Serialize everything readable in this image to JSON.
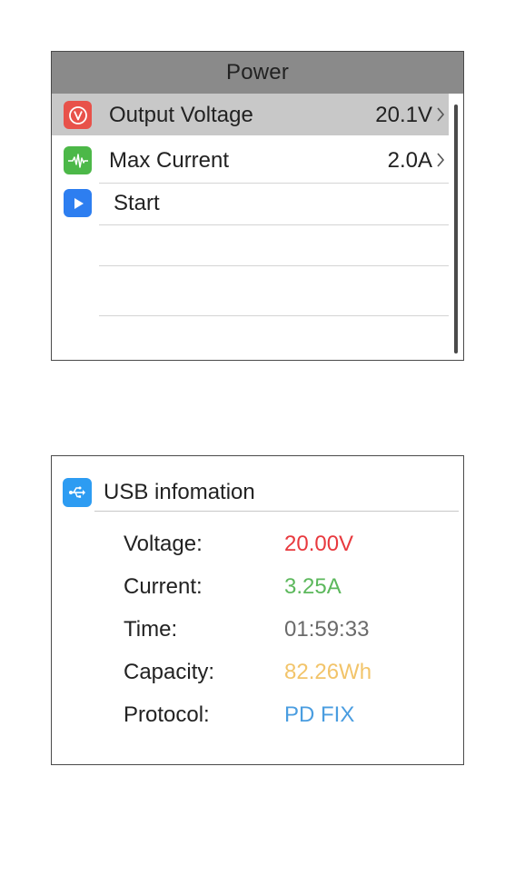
{
  "power": {
    "title": "Power",
    "items": [
      {
        "label": "Output Voltage",
        "value": "20.1V",
        "icon": "voltage-icon",
        "icon_color": "#e8524a",
        "selected": true
      },
      {
        "label": "Max Current",
        "value": "2.0A",
        "icon": "waveform-icon",
        "icon_color": "#4cb848",
        "selected": false
      },
      {
        "label": "Start",
        "value": "",
        "icon": "play-icon",
        "icon_color": "#2d7ef0",
        "selected": false
      }
    ]
  },
  "usb": {
    "title": "USB infomation",
    "icon": "usb-icon",
    "rows": [
      {
        "label": "Voltage:",
        "value": "20.00V",
        "color": "#e8393e"
      },
      {
        "label": "Current:",
        "value": "3.25A",
        "color": "#5cb85c"
      },
      {
        "label": "Time:",
        "value": "01:59:33",
        "color": "#6a6a6a"
      },
      {
        "label": "Capacity:",
        "value": "82.26Wh",
        "color": "#f2c46a"
      },
      {
        "label": "Protocol:",
        "value": "PD FIX",
        "color": "#4a9de0"
      }
    ]
  }
}
